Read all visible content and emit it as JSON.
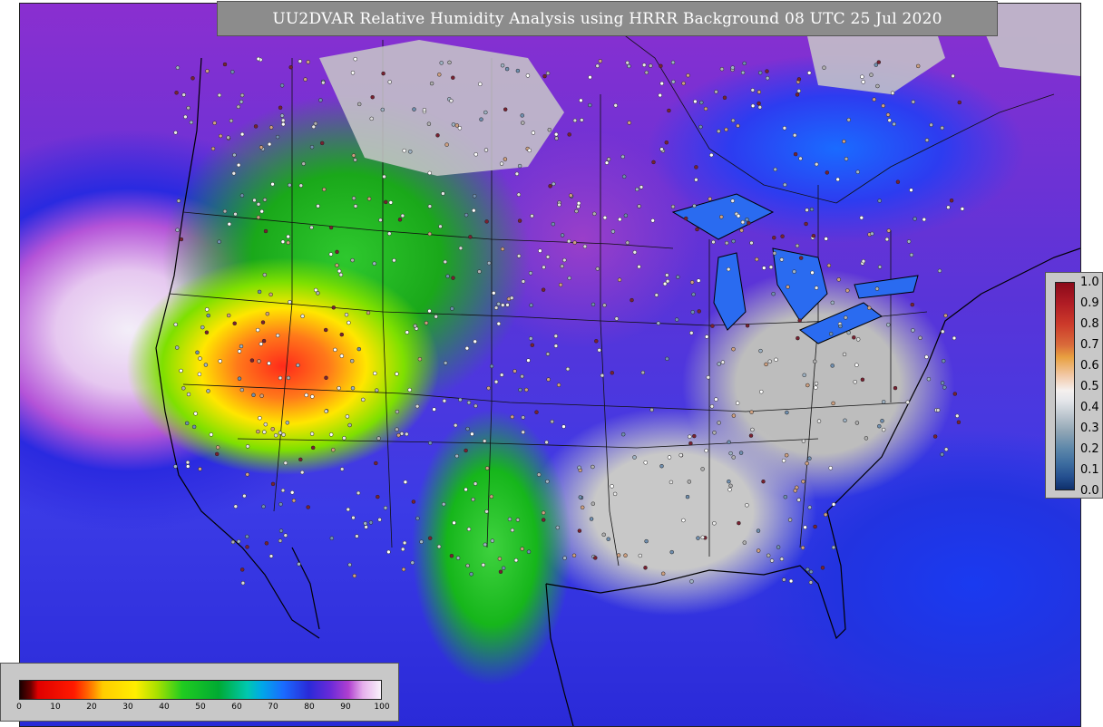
{
  "title": "UU2DVAR Relative Humidity Analysis using HRRR Background 08 UTC 25 Jul 2020",
  "colorbar_right": {
    "labels": [
      "1.0",
      "0.9",
      "0.8",
      "0.7",
      "0.6",
      "0.5",
      "0.4",
      "0.3",
      "0.2",
      "0.1",
      "0.0"
    ]
  },
  "colorbar_bottom": {
    "labels": [
      "0",
      "10",
      "20",
      "30",
      "40",
      "50",
      "60",
      "70",
      "80",
      "90",
      "100"
    ]
  },
  "colors": {
    "frame_bg": "#c8c8c8",
    "title_bg": "#8c8c8c",
    "title_text": "#ffffff"
  }
}
